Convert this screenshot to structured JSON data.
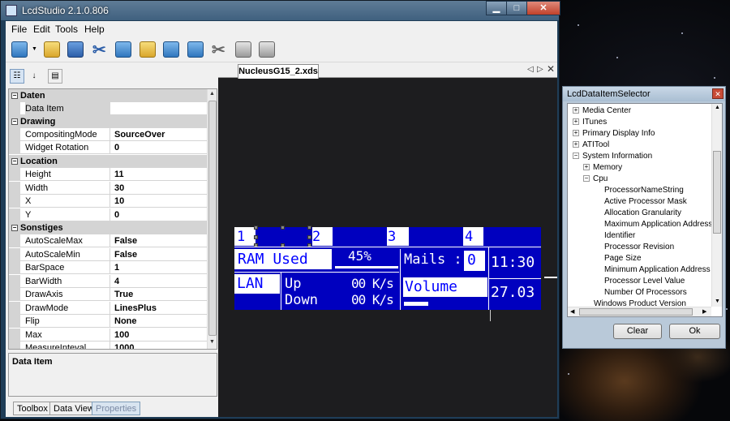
{
  "window": {
    "title": "LcdStudio 2.1.0.806"
  },
  "menu": [
    "File",
    "Edit",
    "Tools",
    "Help"
  ],
  "toolbar": {
    "icons": [
      "new-page-icon",
      "dropdown-icon",
      "open-folder-icon",
      "save-icon",
      "cut-icon",
      "copy-icon",
      "paste-icon",
      "page-icon",
      "page-icon",
      "settings-icon",
      "printer-icon",
      "camera-icon"
    ]
  },
  "properties": {
    "categories": [
      {
        "name": "Daten",
        "rows": [
          {
            "name": "Data Item",
            "value": ""
          }
        ]
      },
      {
        "name": "Drawing",
        "rows": [
          {
            "name": "CompositingMode",
            "value": "SourceOver"
          },
          {
            "name": "Widget Rotation",
            "value": "0"
          }
        ]
      },
      {
        "name": "Location",
        "rows": [
          {
            "name": "Height",
            "value": "11"
          },
          {
            "name": "Width",
            "value": "30"
          },
          {
            "name": "X",
            "value": "10"
          },
          {
            "name": "Y",
            "value": "0"
          }
        ]
      },
      {
        "name": "Sonstiges",
        "rows": [
          {
            "name": "AutoScaleMax",
            "value": "False"
          },
          {
            "name": "AutoScaleMin",
            "value": "False"
          },
          {
            "name": "BarSpace",
            "value": "1"
          },
          {
            "name": "BarWidth",
            "value": "4"
          },
          {
            "name": "DrawAxis",
            "value": "True"
          },
          {
            "name": "DrawMode",
            "value": "LinesPlus"
          },
          {
            "name": "Flip",
            "value": "None"
          },
          {
            "name": "Max",
            "value": "100"
          },
          {
            "name": "MeasureInteval",
            "value": "1000"
          }
        ]
      }
    ],
    "description_title": "Data Item"
  },
  "bottom_tabs": [
    "Toolbox",
    "Data View",
    "Properties"
  ],
  "document": {
    "tab_label": "NucleusG15_2.xds",
    "lcd": {
      "n1": "1",
      "n2": "2",
      "n3": "3",
      "n4": "4",
      "ram_label": "RAM Used",
      "ram_pct": "45%",
      "mails": "Mails :",
      "mails_count": "0",
      "time": "11:30",
      "lan": "LAN",
      "up": "Up",
      "down": "Down",
      "up_val": "00 K/s",
      "down_val": "00 K/s",
      "volume": "Volume",
      "date": "27.03"
    }
  },
  "selector": {
    "title": "LcdDataItemSelector",
    "items": [
      "Media Center",
      "ITunes",
      "Primary Display Info",
      "ATITool",
      "System Information",
      "Memory",
      "Cpu",
      "ProcessorNameString",
      "Active Processor Mask",
      "Allocation Granularity",
      "Maximum Application Address",
      "Identifier",
      "Processor Revision",
      "Page Size",
      "Minimum Application Address",
      "Processor Level Value",
      "Number Of Processors",
      "Windows Product Version"
    ],
    "clear_label": "Clear",
    "ok_label": "Ok"
  }
}
